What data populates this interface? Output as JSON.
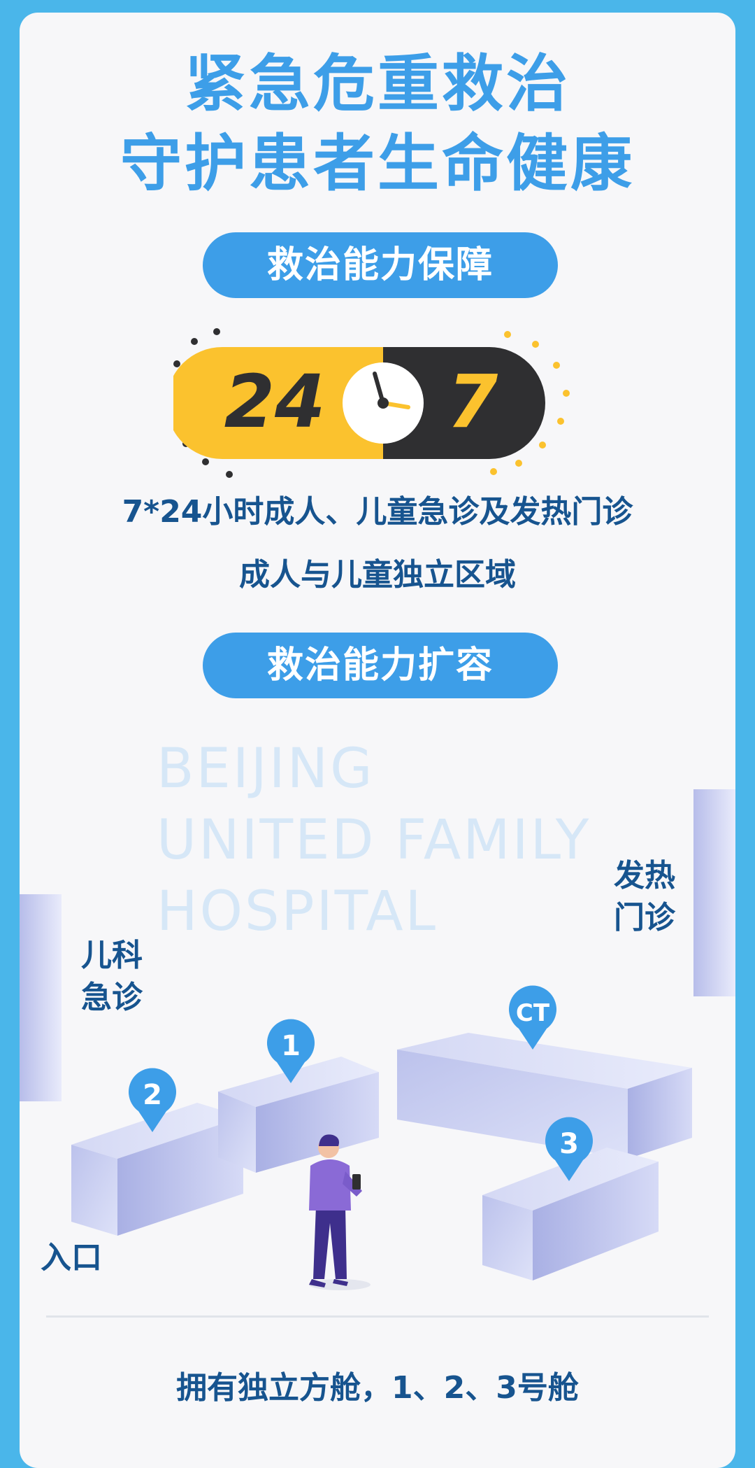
{
  "header": {
    "title_line1": "紧急危重救治",
    "title_line2": "守护患者生命健康"
  },
  "section1": {
    "pill_label": "救治能力保障",
    "badge_left": "24",
    "badge_right": "7",
    "line1": "7*24小时成人、儿童急诊及发热门诊",
    "line2": "成人与儿童独立区域"
  },
  "section2": {
    "pill_label": "救治能力扩容",
    "watermark": [
      "BEIJING",
      "UNITED FAMILY",
      "HOSPITAL"
    ],
    "labels": {
      "fever_1": "发热",
      "fever_2": "门诊",
      "pediatric_1": "儿科",
      "pediatric_2": "急诊",
      "entrance": "入口"
    },
    "pins": {
      "p1": "1",
      "p2": "2",
      "p3": "3",
      "ct": "CT"
    }
  },
  "footer": {
    "text": "拥有独立方舱，1、2、3号舱"
  },
  "colors": {
    "frame": "#4ab6ea",
    "accent_blue": "#3d9ee8",
    "dark_text": "#17548f",
    "yellow": "#fbc22e",
    "dark": "#2f2f31"
  }
}
